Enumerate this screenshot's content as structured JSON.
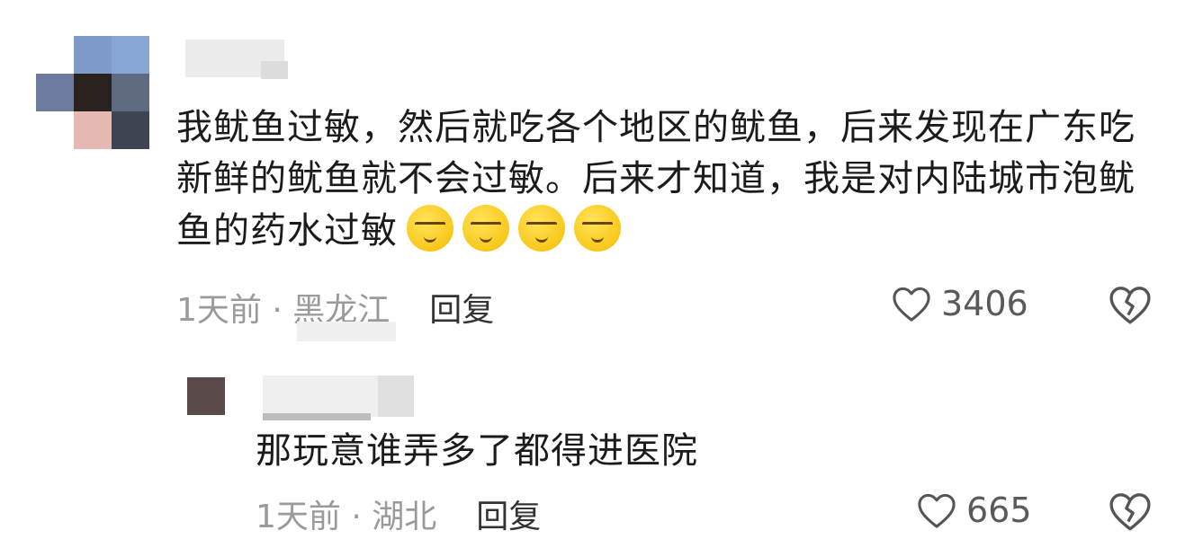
{
  "comments": [
    {
      "text": "我鱿鱼过敏，然后就吃各个地区的鱿鱼，后来发现在广东吃新鲜的鱿鱼就不会过敏。后来才知道，我是对内陆城市泡鱿鱼的药水过敏",
      "emoji_icons": [
        "grimace-face-icon",
        "grimace-face-icon",
        "grimace-face-icon",
        "grimace-face-icon"
      ],
      "time_location": "1天前 · 黑龙江",
      "reply_label": "回复",
      "like_count": "3406"
    },
    {
      "text": "那玩意谁弄多了都得进医院",
      "time_location": "1天前 · 湖北",
      "reply_label": "回复",
      "like_count": "665"
    }
  ],
  "colors": {
    "text": "#1b1b1b",
    "meta": "#9a9a9a",
    "emoji": "#f9c81a"
  }
}
